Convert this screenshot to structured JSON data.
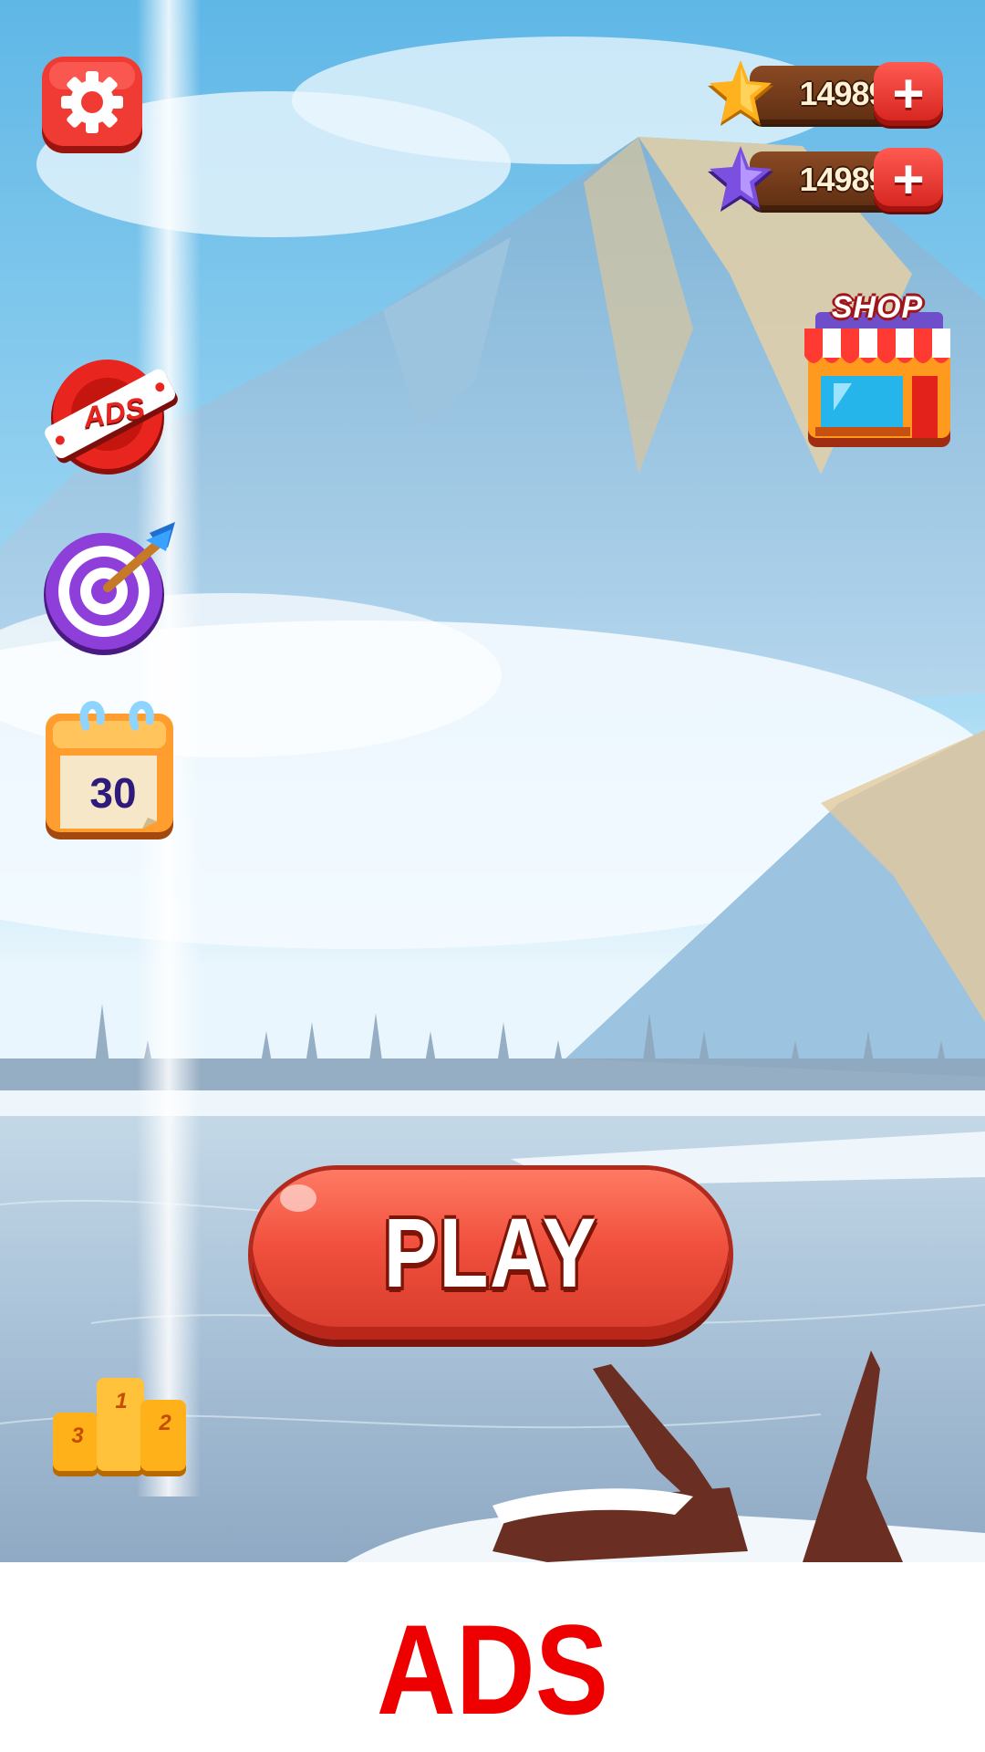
{
  "currencies": [
    {
      "icon": "gold-star-icon",
      "amount": "14989",
      "plus": "+"
    },
    {
      "icon": "purple-star-icon",
      "amount": "14989",
      "plus": "+"
    }
  ],
  "shop": {
    "label": "SHOP"
  },
  "menu": {
    "settings_icon": "gear-icon",
    "remove_ads_label": "ADS",
    "target_icon": "target-icon",
    "daily_calendar_day": "30",
    "leaderboard": {
      "icon": "podium-icon",
      "first": "1",
      "second": "2",
      "third": "3"
    }
  },
  "play": {
    "label": "PLAY"
  },
  "banner": {
    "label": "ADS"
  },
  "colors": {
    "accent_red": "#e8372c",
    "banner_red": "#ee0000",
    "wood": "#6b3617"
  }
}
